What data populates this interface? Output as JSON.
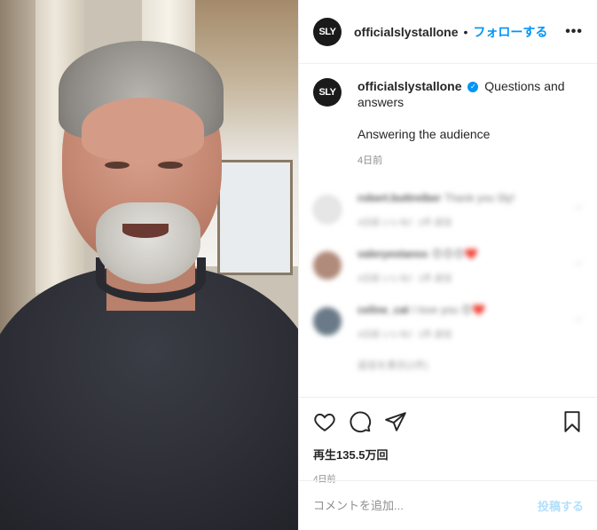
{
  "post": {
    "username": "officialslystallone",
    "avatar_text": "SLY",
    "follow_label": "フォローする",
    "more_label": "•••"
  },
  "caption": {
    "username": "officialslystallone",
    "verified_glyph": "✓",
    "text": "Questions and answers",
    "line2": "Answering the audience",
    "time": "4日前"
  },
  "comments": [
    {
      "name": "robert.buttreiber",
      "msg": "Thank you Sly!",
      "meta": "4日前   いいね！1件   返信",
      "avatar_color": "#e6e6e6"
    },
    {
      "name": "valeryestanss",
      "msg": "😍😍😍❤️",
      "meta": "4日前   いいね！1件   返信",
      "avatar_color": "#b08a7a"
    },
    {
      "name": "celine_cat",
      "msg": "I love you 😍❤️",
      "meta": "4日前   いいね！1件   返信",
      "avatar_color": "#6a7a88"
    }
  ],
  "more_replies": "返信を表示(1件)",
  "actions": {
    "views": "再生135.5万回",
    "time": "4日前"
  },
  "add_comment": {
    "placeholder": "コメントを追加...",
    "post_label": "投稿する"
  }
}
